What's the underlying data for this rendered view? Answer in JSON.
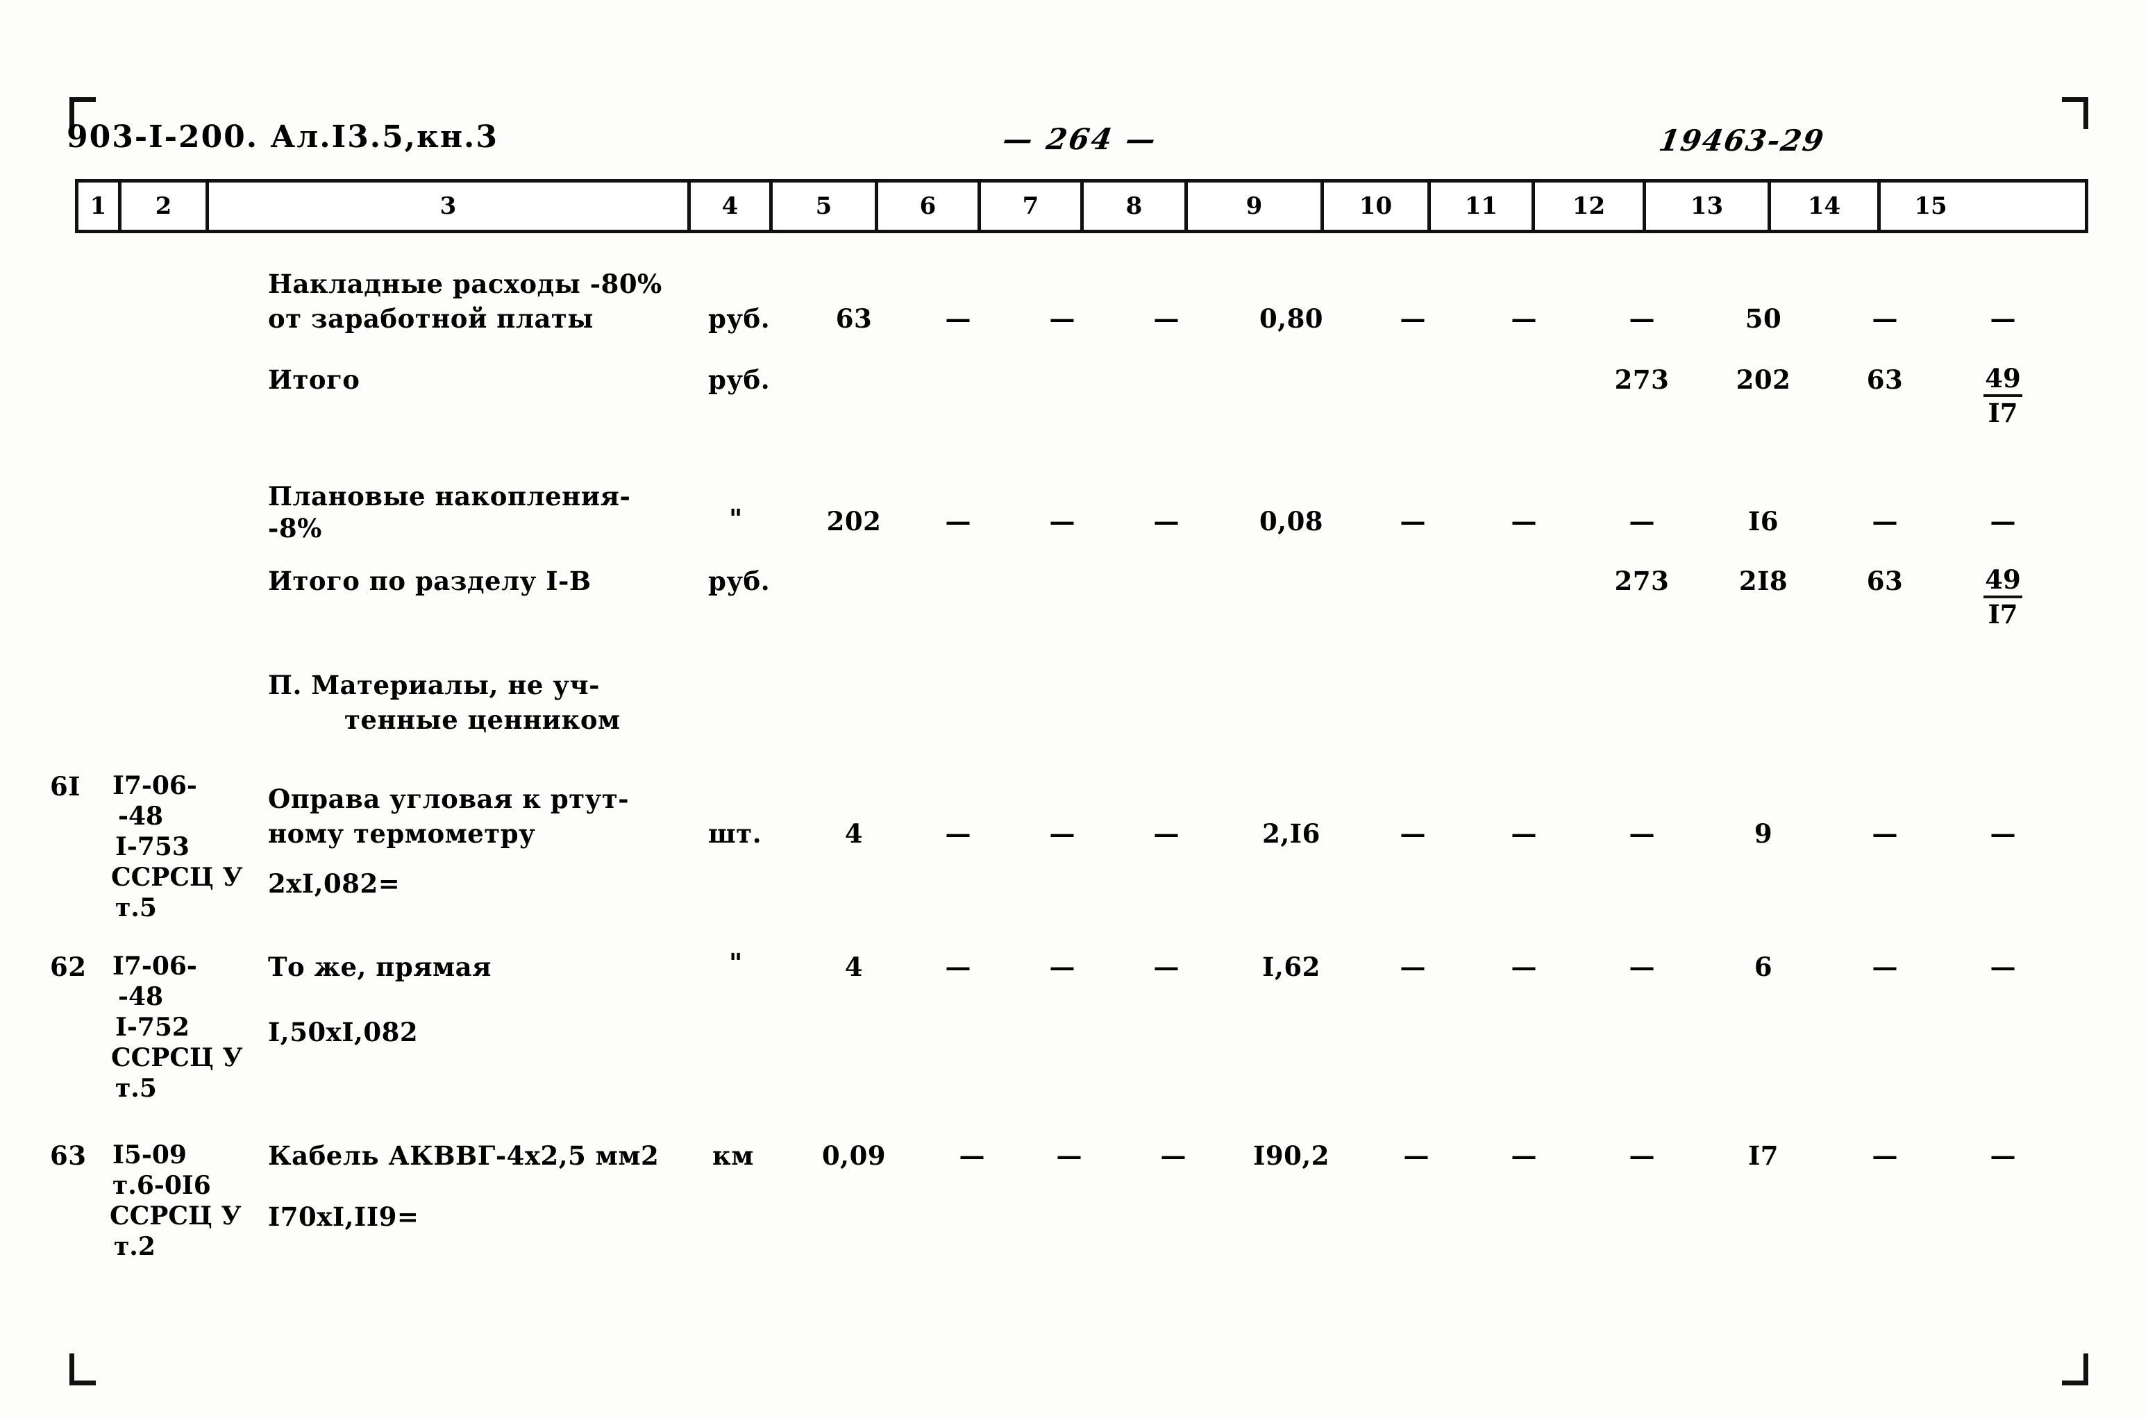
{
  "page": {
    "doc_code": "903-I-200. Ал.I3.5,кн.3",
    "page_number": "— 264 —",
    "archive_number": "19463-29"
  },
  "table": {
    "column_headers": [
      "1",
      "2",
      "3",
      "4",
      "5",
      "6",
      "7",
      "8",
      "9",
      "10",
      "11",
      "12",
      "13",
      "14",
      "15"
    ],
    "rows": [
      {
        "id": "row-overhead",
        "num": "",
        "code": "",
        "desc_line1": "Накладные расходы -80%",
        "desc_line2": "от заработной платы",
        "unit": "руб.",
        "c5": "63",
        "c6": "—",
        "c7": "—",
        "c8": "—",
        "c9": "0,80",
        "c10": "—",
        "c11": "—",
        "c12": "—",
        "c13": "50",
        "c14": "—",
        "c15": "—"
      },
      {
        "id": "row-itogo",
        "num": "",
        "code": "",
        "desc_line1": "Итого",
        "desc_line2": "",
        "unit": "руб.",
        "c5": "",
        "c6": "",
        "c7": "",
        "c8": "",
        "c9": "",
        "c10": "",
        "c11": "",
        "c12": "273",
        "c13": "202",
        "c14": "63",
        "c15_top": "49",
        "c15_bot": "I7"
      },
      {
        "id": "row-planovye",
        "num": "",
        "code": "",
        "desc_line1": "Плановые накопления-",
        "desc_line2": "-8%",
        "unit": "\"",
        "c5": "202",
        "c6": "—",
        "c7": "—",
        "c8": "—",
        "c9": "0,08",
        "c10": "—",
        "c11": "—",
        "c12": "—",
        "c13": "I6",
        "c14": "—",
        "c15": "—"
      },
      {
        "id": "row-itogo-razdel",
        "num": "",
        "code": "",
        "desc_line1": "Итого по разделу I-B",
        "desc_line2": "",
        "unit": "руб.",
        "c5": "",
        "c6": "",
        "c7": "",
        "c8": "",
        "c9": "",
        "c10": "",
        "c11": "",
        "c12": "273",
        "c13": "2I8",
        "c14": "63",
        "c15_top": "49",
        "c15_bot": "I7"
      }
    ],
    "section_heading": {
      "line1": "П. Материалы, не уч-",
      "line2": "тенные ценником"
    },
    "material_rows": [
      {
        "id": "row-61",
        "num": "6I",
        "code_line1": "I7-06-",
        "code_line2": "-48",
        "code_line3": "I-753",
        "code_line4": "ССРСЦ У",
        "code_line5": "т.5",
        "desc_line1": "Оправа угловая к ртут-",
        "desc_line2": "ному термометру",
        "desc_line3": "2xI,082=",
        "unit": "шт.",
        "c5": "4",
        "c6": "—",
        "c7": "—",
        "c8": "—",
        "c9": "2,I6",
        "c10": "—",
        "c11": "—",
        "c12": "—",
        "c13": "9",
        "c14": "—",
        "c15": "—"
      },
      {
        "id": "row-62",
        "num": "62",
        "code_line1": "I7-06-",
        "code_line2": "-48",
        "code_line3": "I-752",
        "code_line4": "ССРСЦ У",
        "code_line5": "т.5",
        "desc_line1": "То же, прямая",
        "desc_line2": "I,50xI,082",
        "desc_line3": "",
        "unit": "\"",
        "c5": "4",
        "c6": "—",
        "c7": "—",
        "c8": "—",
        "c9": "I,62",
        "c10": "—",
        "c11": "—",
        "c12": "—",
        "c13": "6",
        "c14": "—",
        "c15": "—"
      },
      {
        "id": "row-63",
        "num": "63",
        "code_line1": "I5-09",
        "code_line2": "т.6-0I6",
        "code_line3": "ССРСЦ У",
        "code_line4": "т.2",
        "code_line5": "",
        "desc_line1": "Кабель АКВВГ-4x2,5 мм2",
        "desc_line2": "I70xI,II9=",
        "desc_line3": "",
        "unit": "км",
        "c5": "0,09",
        "c6": "—",
        "c7": "—",
        "c8": "—",
        "c9": "I90,2",
        "c10": "—",
        "c11": "—",
        "c12": "—",
        "c13": "I7",
        "c14": "—",
        "c15": "—"
      }
    ]
  }
}
